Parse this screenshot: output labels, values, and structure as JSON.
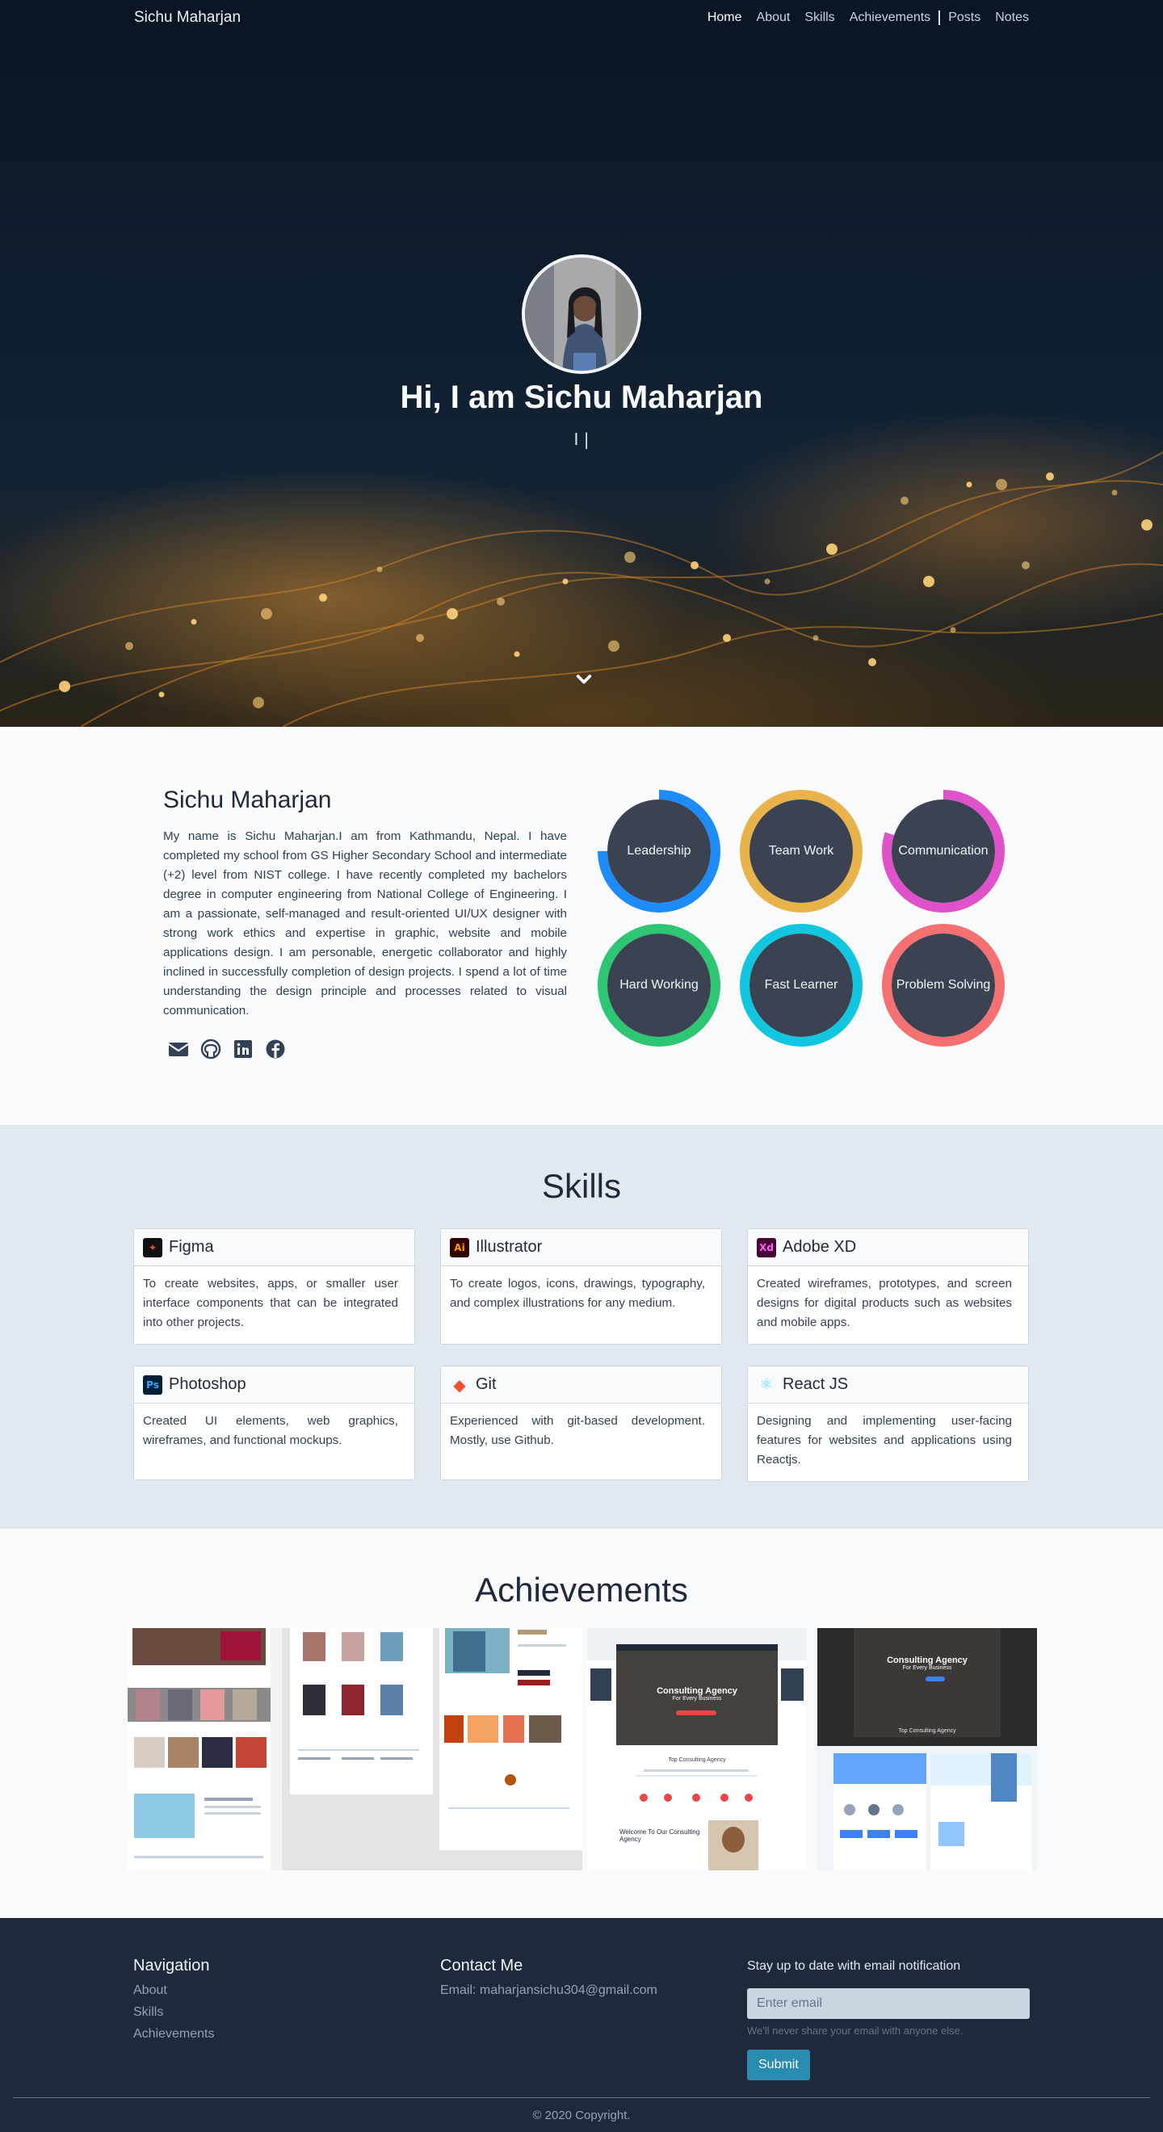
{
  "nav": {
    "brand": "Sichu Maharjan",
    "links": [
      "Home",
      "About",
      "Skills",
      "Achievements",
      "Posts",
      "Notes"
    ]
  },
  "hero": {
    "title": "Hi, I am Sichu Maharjan",
    "typed_text": "I |",
    "scroll_icon": "chevron-down-icon"
  },
  "about": {
    "name": "Sichu Maharjan",
    "bio": "My name is Sichu Maharjan.I am from Kathmandu, Nepal. I have completed my school from GS Higher Secondary School and intermediate (+2) level from NIST college. I have recently completed my bachelors degree in computer engineering from National College of Engineering. I am a passionate, self-managed and result-oriented UI/UX designer with strong work ethics and expertise in graphic, website and mobile applications design. I am personable, energetic collaborator and highly inclined in successfully completion of design projects. I spend a lot of time understanding the design principle and processes related to visual communication.",
    "social_icons": [
      "email-icon",
      "github-icon",
      "linkedin-icon",
      "facebook-icon"
    ],
    "traits": [
      {
        "label": "Leadership",
        "color": "#1d8cf8",
        "level": 0.75
      },
      {
        "label": "Team Work",
        "color": "#e8b34a",
        "level": 1.0
      },
      {
        "label": "Communication",
        "color": "#e052c9",
        "level": 0.8
      },
      {
        "label": "Hard Working",
        "color": "#2ec573",
        "level": 1.0
      },
      {
        "label": "Fast Learner",
        "color": "#12c6e0",
        "level": 1.0
      },
      {
        "label": "Problem Solving",
        "color": "#f57070",
        "level": 1.0
      }
    ]
  },
  "skills": {
    "title": "Skills",
    "items": [
      {
        "name": "Figma",
        "icon": "figma-icon",
        "desc": "To create websites, apps, or smaller user interface components that can be integrated into other projects."
      },
      {
        "name": "Illustrator",
        "icon": "illustrator-icon",
        "desc": "To create logos, icons, drawings, typography, and complex illustrations for any medium."
      },
      {
        "name": "Adobe XD",
        "icon": "adobe-xd-icon",
        "desc": "Created wireframes, prototypes, and screen designs for digital products such as websites and mobile apps."
      },
      {
        "name": "Photoshop",
        "icon": "photoshop-icon",
        "desc": "Created UI elements, web graphics, wireframes, and functional mockups."
      },
      {
        "name": "Git",
        "icon": "git-icon",
        "desc": "Experienced with git-based development. Mostly, use Github."
      },
      {
        "name": "React JS",
        "icon": "react-icon",
        "desc": "Designing and implementing user-facing features for websites and applications using Reactjs."
      }
    ]
  },
  "achievements": {
    "title": "Achievements",
    "shots": [
      {
        "caption": "",
        "accent": "#7c2d12"
      },
      {
        "caption": "",
        "accent": "#9f1239"
      },
      {
        "caption": "",
        "accent": "#0f766e"
      },
      {
        "caption": "Consulting Agency",
        "sub": "For Every Business",
        "accent": "#ef4444"
      },
      {
        "caption": "Consulting Agency",
        "sub": "For Every Business",
        "accent": "#0ea5e9"
      }
    ],
    "shot_texts": {
      "consulting_title": "Consulting Agency",
      "consulting_sub": "For Every Business",
      "top_consulting": "Top Consulting Agency",
      "welcome": "Welcome To Our Consulting Agency"
    }
  },
  "footer": {
    "nav_title": "Navigation",
    "nav_links": [
      "About",
      "Skills",
      "Achievements"
    ],
    "contact_title": "Contact Me",
    "contact_email": "Email: maharjansichu304@gmail.com",
    "subscribe_title": "Stay up to date with email notification",
    "email_placeholder": "Enter email",
    "help_text": "We'll never share your email with anyone else.",
    "submit_label": "Submit",
    "copyright": "© 2020 Copyright."
  }
}
